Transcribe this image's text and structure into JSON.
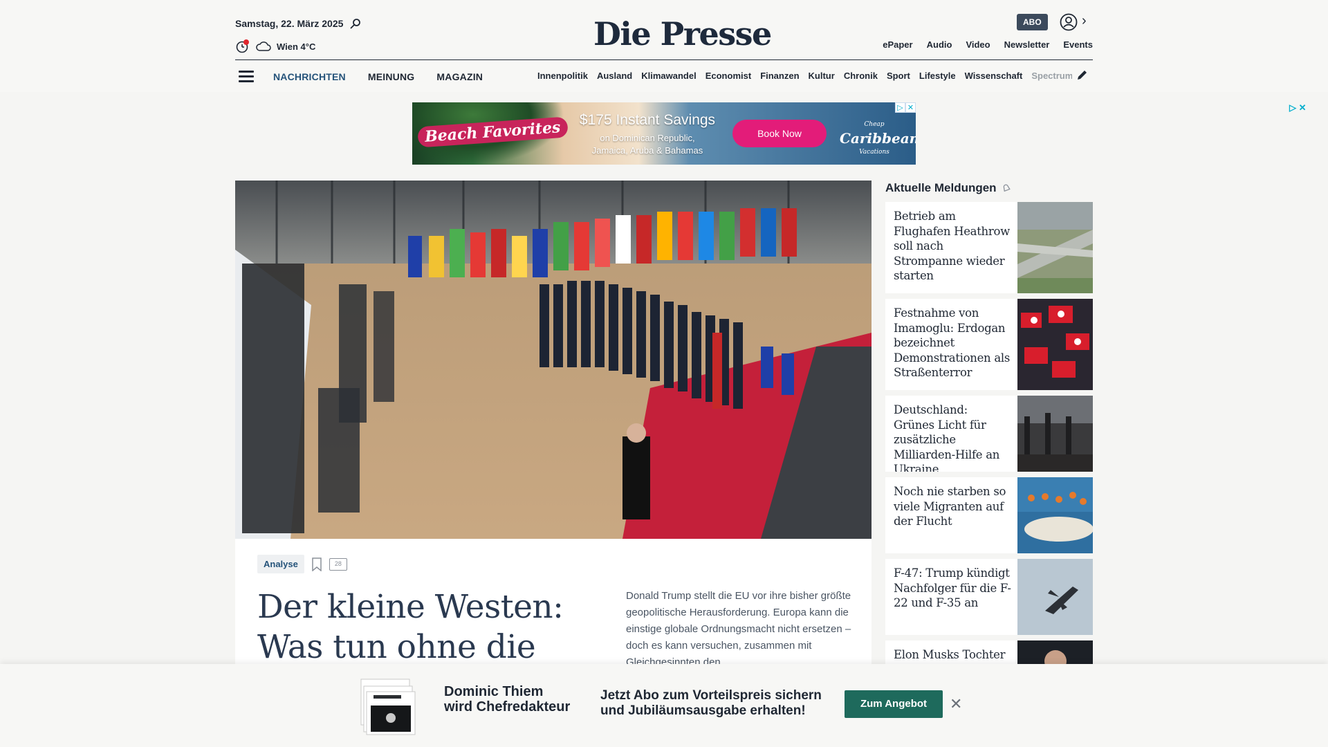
{
  "header": {
    "date": "Samstag, 22. März 2025",
    "weather": "Wien 4°C",
    "logo": "Die Presse",
    "abo_label": "ABO",
    "top_links": [
      "ePaper",
      "Audio",
      "Video",
      "Newsletter",
      "Events"
    ]
  },
  "nav": {
    "main": [
      "NACHRICHTEN",
      "MEINUNG",
      "MAGAZIN"
    ],
    "sub": [
      "Innenpolitik",
      "Ausland",
      "Klimawandel",
      "Economist",
      "Finanzen",
      "Kultur",
      "Chronik",
      "Sport",
      "Lifestyle",
      "Wissenschaft",
      "Spectrum"
    ]
  },
  "ad": {
    "badge": "Beach Favorites",
    "title": "$175 Instant Savings",
    "sub1": "on Dominican Republic,",
    "sub2": "Jamaica, Aruba & Bahamas",
    "button": "Book Now",
    "brand_small": "Cheap",
    "brand": "Caribbean",
    "brand_sub": "Vacations"
  },
  "hero": {
    "tag": "Analyse",
    "comments": "28",
    "headline_1": "Der kleine Westen:",
    "headline_2": "Was tun ohne die USA?",
    "teaser": "Donald Trump stellt die EU vor ihre bisher größte geopolitische Herausforderung. Europa kann die einstige globale Ordnungsmacht nicht ersetzen – doch es kann versuchen, zusammen mit Gleichgesinnten den"
  },
  "sidebar": {
    "title": "Aktuelle Meldungen",
    "items": [
      {
        "title": "Betrieb am Flughafen Heathrow soll nach Strompanne wieder starten"
      },
      {
        "title": "Festnahme von Imamoglu: Erdogan bezeichnet Demonstrationen als Straßenterror"
      },
      {
        "title": "Deutschland: Grünes Licht für zusätzliche Milliarden-Hilfe an Ukraine"
      },
      {
        "title": "Noch nie starben so viele Migranten auf der Flucht"
      },
      {
        "title": "F-47: Trump kündigt Nachfolger für die F-22 und F-35 an"
      },
      {
        "title": "Elon Musks Tochter"
      }
    ]
  },
  "promo": {
    "name_1": "Dominic Thiem",
    "name_2": "wird Chefredakteur",
    "text_1": "Jetzt Abo zum Vorteilspreis sichern",
    "text_2": "und Jubiläumsausgabe erhalten!",
    "button": "Zum Angebot"
  },
  "colors": {
    "accent_blue": "#25537a",
    "promo_green": "#1e6a5c",
    "ad_pink": "#e31c79"
  }
}
